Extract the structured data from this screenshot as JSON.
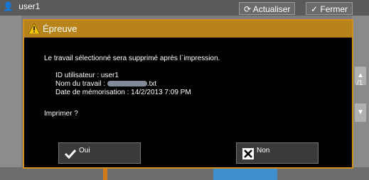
{
  "background": {
    "user_name": "user1",
    "refresh_label": "Actualiser",
    "close_label": "Fermer",
    "page_indicator": "/1"
  },
  "dialog": {
    "title": "Épreuve",
    "message": "Le travail sélectionné sera supprimé après l`impression.",
    "details": {
      "user_id": "ID utilisateur : user1",
      "job_name_prefix": "Nom du travail : ",
      "job_name_suffix": ".txt",
      "stored_date": "Date de mémorisation : 14/2/2013 7:09 PM"
    },
    "question": "Imprimer ?",
    "yes_label": "Oui",
    "no_label": "Non"
  },
  "colors": {
    "dialog_title_bg": "#b8831a",
    "dialog_border": "#d08f1e",
    "dialog_bg": "#000000",
    "warning_icon": "#f5c400"
  }
}
